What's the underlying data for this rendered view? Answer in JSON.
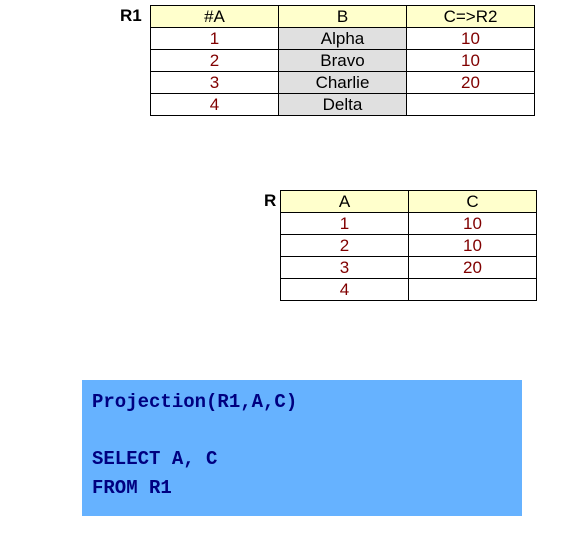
{
  "r1": {
    "label": "R1",
    "headers": [
      "#A",
      "B",
      "C=>R2"
    ],
    "rows": [
      {
        "a": "1",
        "b": "Alpha",
        "c": "10"
      },
      {
        "a": "2",
        "b": "Bravo",
        "c": "10"
      },
      {
        "a": "3",
        "b": "Charlie",
        "c": "20"
      },
      {
        "a": "4",
        "b": "Delta",
        "c": ""
      }
    ]
  },
  "r": {
    "label": "R",
    "headers": [
      "A",
      "C"
    ],
    "rows": [
      {
        "a": "1",
        "c": "10"
      },
      {
        "a": "2",
        "c": "10"
      },
      {
        "a": "3",
        "c": "20"
      },
      {
        "a": "4",
        "c": ""
      }
    ]
  },
  "code": {
    "line1": "Projection(R1,A,C)",
    "line2": "",
    "line3": "SELECT A, C",
    "line4": "FROM R1"
  },
  "chart_data": [
    {
      "type": "table",
      "name": "R1",
      "columns": [
        "#A",
        "B",
        "C=>R2"
      ],
      "rows": [
        [
          1,
          "Alpha",
          10
        ],
        [
          2,
          "Bravo",
          10
        ],
        [
          3,
          "Charlie",
          20
        ],
        [
          4,
          "Delta",
          null
        ]
      ]
    },
    {
      "type": "table",
      "name": "R",
      "columns": [
        "A",
        "C"
      ],
      "rows": [
        [
          1,
          10
        ],
        [
          2,
          10
        ],
        [
          3,
          20
        ],
        [
          4,
          null
        ]
      ]
    }
  ]
}
